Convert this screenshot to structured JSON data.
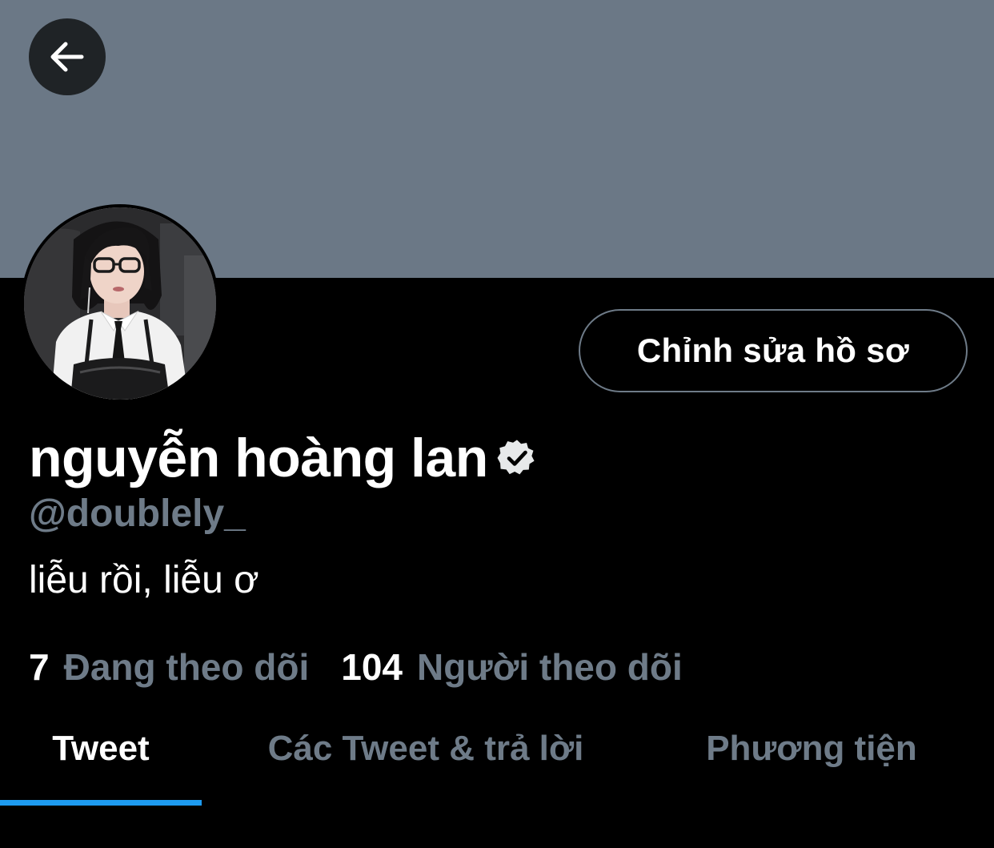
{
  "profile": {
    "display_name": "nguyễn hoàng lan",
    "handle": "@doublely_",
    "bio": "liễu rồi, liễu ơ",
    "edit_button_label": "Chỉnh sửa hồ sơ",
    "verified": true
  },
  "stats": {
    "following_count": "7",
    "following_label": "Đang theo dõi",
    "followers_count": "104",
    "followers_label": "Người theo dõi"
  },
  "tabs": [
    {
      "label": "Tweet",
      "active": true
    },
    {
      "label": "Các Tweet & trả lời",
      "active": false
    },
    {
      "label": "Phương tiện",
      "active": false
    }
  ],
  "icons": {
    "back": "arrow-left-icon",
    "verified": "verified-badge-icon"
  },
  "colors": {
    "banner": "#6b7886",
    "background": "#000000",
    "muted_text": "#6e7b88",
    "accent": "#1d9bf0"
  }
}
